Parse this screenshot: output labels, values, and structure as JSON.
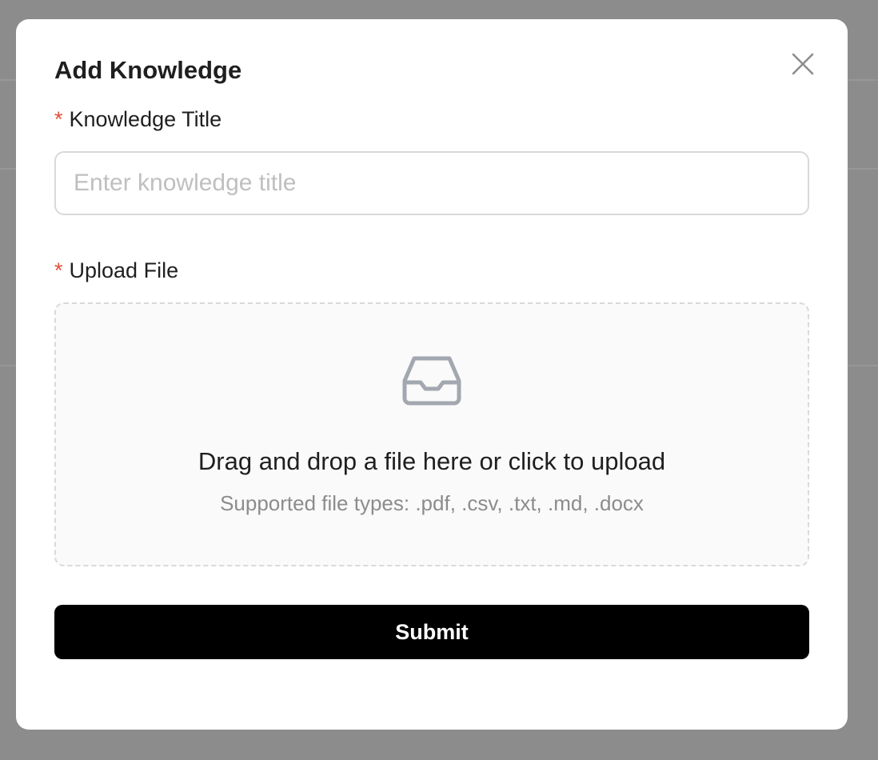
{
  "modal": {
    "title": "Add Knowledge",
    "close_icon": "close-icon"
  },
  "form": {
    "title_field": {
      "required_mark": "*",
      "label": "Knowledge Title",
      "placeholder": "Enter knowledge title",
      "value": ""
    },
    "upload_field": {
      "required_mark": "*",
      "label": "Upload File",
      "icon": "inbox-icon",
      "drop_text": "Drag and drop a file here or click to upload",
      "hint_text": "Supported file types: .pdf, .csv, .txt, .md, .docx"
    },
    "submit_label": "Submit"
  },
  "colors": {
    "overlay": "#8c8c8c",
    "required": "#e0503a",
    "submit_bg": "#000000",
    "border": "#d9d9d9"
  }
}
